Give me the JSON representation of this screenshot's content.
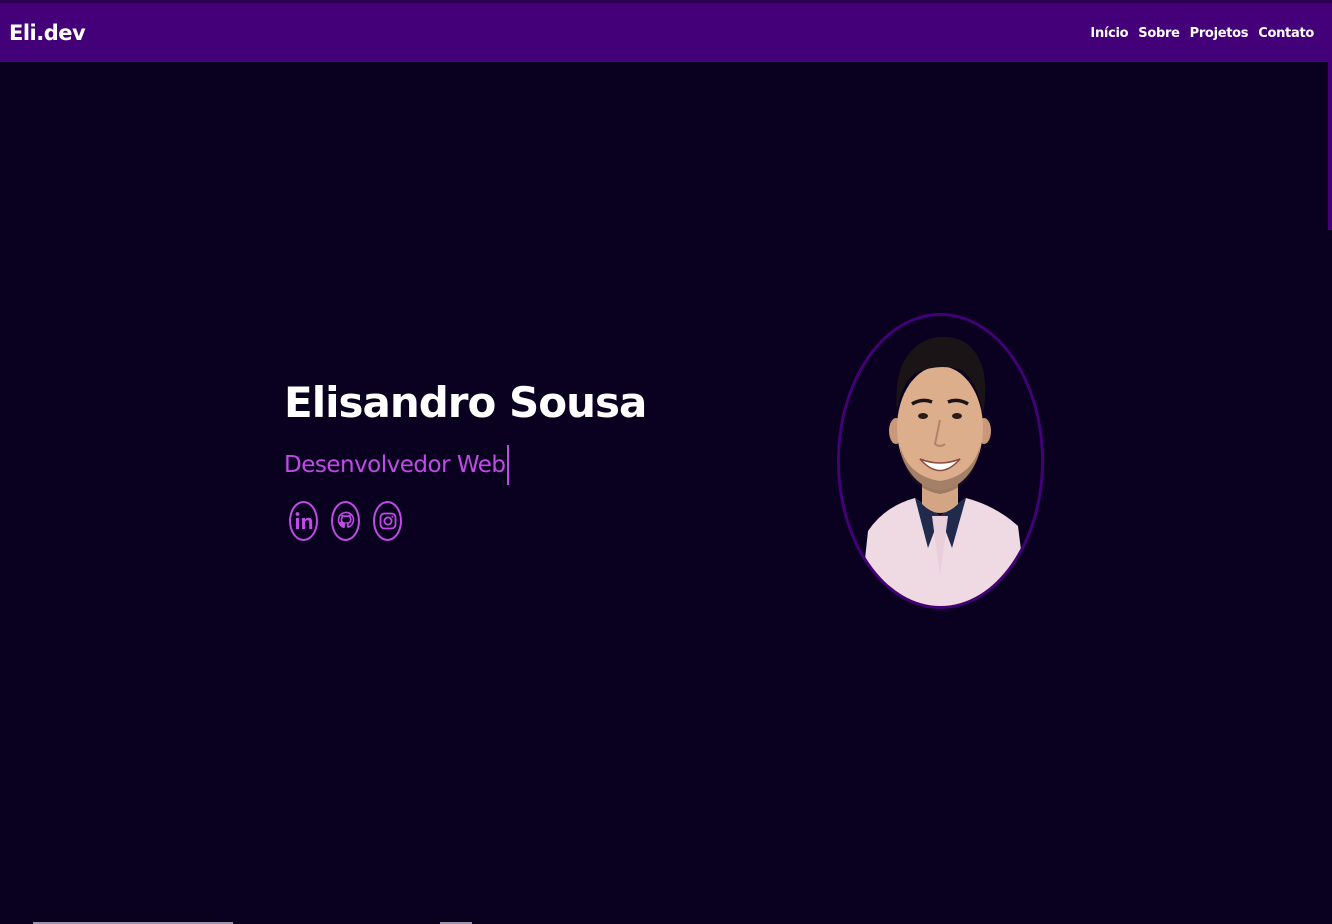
{
  "header": {
    "brand": "Eli.dev",
    "nav": [
      {
        "label": "Início"
      },
      {
        "label": "Sobre"
      },
      {
        "label": "Projetos"
      },
      {
        "label": "Contato"
      }
    ]
  },
  "hero": {
    "name": "Elisandro Sousa",
    "role": "Desenvolvedor Web",
    "socials": [
      {
        "icon": "linkedin-icon"
      },
      {
        "icon": "github-icon"
      },
      {
        "icon": "instagram-icon"
      }
    ],
    "photo_alt": "profile-photo"
  },
  "colors": {
    "header_bg": "#440079",
    "page_bg": "#0a0020",
    "accent": "#c04be6",
    "text": "#ffffff"
  }
}
